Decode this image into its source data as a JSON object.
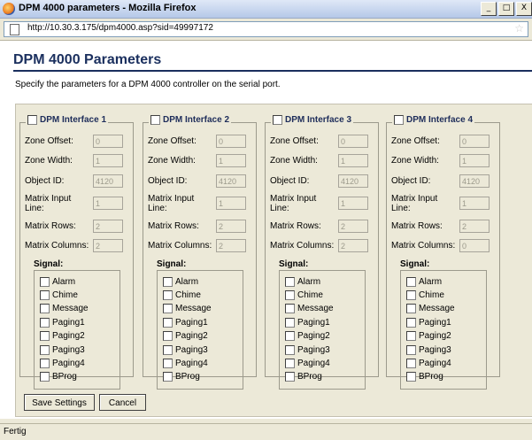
{
  "window": {
    "title": "DPM 4000 parameters - Mozilla Firefox",
    "buttons": [
      "_",
      "□",
      "X"
    ]
  },
  "address": {
    "url": "http://10.30.3.175/dpm4000.asp?sid=49997172"
  },
  "page": {
    "title": "DPM 4000 Parameters",
    "description": "Specify the parameters for a DPM 4000 controller on the serial port."
  },
  "labels": {
    "zone_offset": "Zone Offset:",
    "zone_width": "Zone Width:",
    "object_id": "Object ID:",
    "matrix_input_line": "Matrix Input Line:",
    "matrix_rows": "Matrix Rows:",
    "matrix_columns": "Matrix Columns:",
    "signal": "Signal:"
  },
  "signals": [
    "Alarm",
    "Chime",
    "Message",
    "Paging1",
    "Paging2",
    "Paging3",
    "Paging4",
    "BProg"
  ],
  "interfaces": [
    {
      "name": "DPM Interface 1",
      "zone_offset": "0",
      "zone_width": "1",
      "object_id": "4120",
      "matrix_input_line": "1",
      "matrix_rows": "2",
      "matrix_columns": "2"
    },
    {
      "name": "DPM Interface 2",
      "zone_offset": "0",
      "zone_width": "1",
      "object_id": "4120",
      "matrix_input_line": "1",
      "matrix_rows": "2",
      "matrix_columns": "2"
    },
    {
      "name": "DPM Interface 3",
      "zone_offset": "0",
      "zone_width": "1",
      "object_id": "4120",
      "matrix_input_line": "1",
      "matrix_rows": "2",
      "matrix_columns": "2"
    },
    {
      "name": "DPM Interface 4",
      "zone_offset": "0",
      "zone_width": "1",
      "object_id": "4120",
      "matrix_input_line": "1",
      "matrix_rows": "2",
      "matrix_columns": "0"
    }
  ],
  "buttons": {
    "save": "Save Settings",
    "cancel": "Cancel"
  },
  "status": {
    "text": "Fertig"
  }
}
